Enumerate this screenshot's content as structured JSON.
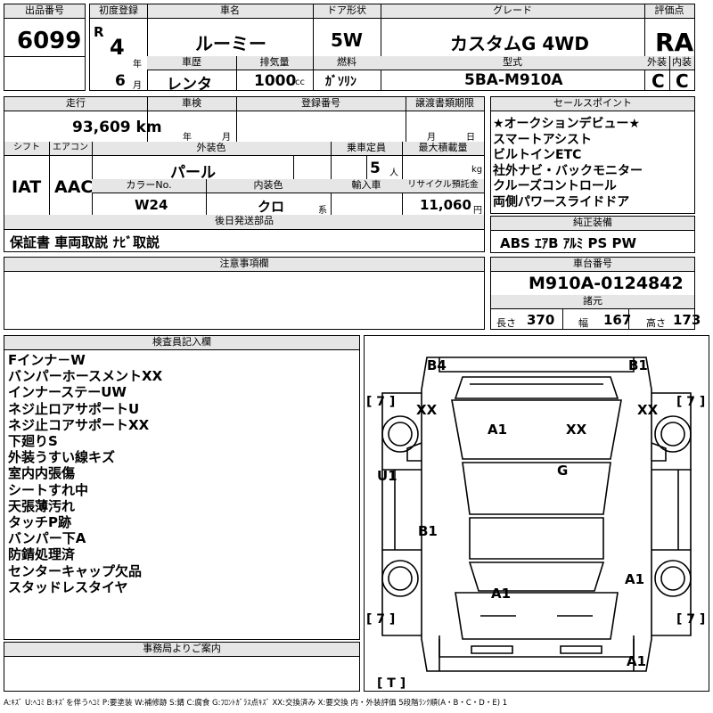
{
  "header": {
    "lot_label": "出品番号",
    "lot": "6099",
    "first_reg_label": "初度登録",
    "era": "R",
    "year": "4",
    "year_unit": "年",
    "month": "6",
    "month_unit": "月",
    "car_name_label": "車名",
    "car_name": "ルーミー",
    "door_label": "ドア形状",
    "door": "5W",
    "grade_label": "グレード",
    "grade": "カスタムG 4WD",
    "score_label": "評価点",
    "score": "RA",
    "history_label": "車歴",
    "history": "レンタ",
    "displacement_label": "排気量",
    "displacement": "1000",
    "displacement_unit": "cc",
    "fuel_label": "燃料",
    "fuel": "ｶﾞｿﾘﾝ",
    "model_label": "型式",
    "model": "5BA-M910A",
    "ext_label": "外装",
    "ext_grade": "C",
    "int_label": "内装",
    "int_grade": "C"
  },
  "row2": {
    "mileage_label": "走行",
    "mileage": "93,609 km",
    "inspection_label": "車検",
    "year_unit": "年",
    "month_unit": "月",
    "reg_label": "登録番号",
    "transfer_label": "譲渡書類期限",
    "day_unit": "日"
  },
  "row3": {
    "shift_label": "シフト",
    "shift": "IAT",
    "ac_label": "エアコン",
    "ac": "AAC",
    "color_label": "外装色",
    "color": "パール",
    "capacity_label": "乗車定員",
    "capacity": "5",
    "capacity_unit": "人",
    "load_label": "最大積載量",
    "load_unit": "kg",
    "color_no_label": "カラーNo.",
    "color_no": "W24",
    "interior_label": "内装色",
    "interior": "クロ",
    "interior_unit": "系",
    "import_label": "輸入車",
    "recycle_label": "リサイクル預託金",
    "recycle": "11,060",
    "recycle_unit": "円"
  },
  "sales": {
    "label": "セールスポイント",
    "items": [
      "★オークションデビュー★",
      "スマートアシスト",
      "ビルトインETC",
      "社外ナビ・バックモニター",
      "クルーズコントロール",
      "両側パワースライドドア"
    ]
  },
  "later": {
    "label": "後日発送部品",
    "text": "保証書 車両取説 ﾅﾋﾞ取説"
  },
  "equip": {
    "label": "純正装備",
    "text": "ABS ｴｱB ｱﾙﾐ PS PW"
  },
  "notes": {
    "label": "注意事項欄"
  },
  "chassis": {
    "label": "車台番号",
    "value": "M910A-0124842"
  },
  "dims": {
    "label": "諸元",
    "len_label": "長さ",
    "len": "370",
    "wid_label": "幅",
    "wid": "167",
    "hgt_label": "高さ",
    "hgt": "173"
  },
  "inspector": {
    "label": "検査員記入欄",
    "items": [
      "Fインナ－W",
      "バンパーホースメントXX",
      "インナーステーUW",
      "ネジ止ロアサポートU",
      "ネジ止コアサポートXX",
      "下廻りS",
      "外装うすい線キズ",
      "室内内張傷",
      "シートすれ中",
      "天張薄汚れ",
      "タッチP跡",
      "バンパー下A",
      "防錆処理済",
      "センターキャップ欠品",
      "スタッドレスタイヤ"
    ]
  },
  "office": {
    "label": "事務局よりご案内"
  },
  "diagram": {
    "marks": {
      "b4": "B4",
      "b1_top": "B1",
      "xx_l": "XX",
      "xx_r": "XX",
      "a1_hood": "A1",
      "xx_hood": "XX",
      "u1": "U1",
      "g": "G",
      "b1_mid": "B1",
      "a1_rear_r": "A1",
      "a1_tail": "A1",
      "a1_bottom": "A1"
    },
    "tires": {
      "fl": "[ 7 ]",
      "fr": "[ 7 ]",
      "rl": "[ 7 ]",
      "rr": "[ 7 ]",
      "spare": "[ T ]"
    }
  },
  "legend": "A:ｷｽﾞ U:ﾍｺﾐ B:ｷｽﾞを伴うﾍｺﾐ P:要塗装 W:補修跡 S:錆 C:腐食 G:ﾌﾛﾝﾄｶﾞﾗｽ点ｷｽﾞ XX:交換済み X:要交換 内・外装評価 5段階ﾗﾝｸ順(A・B・C・D・E) 1"
}
